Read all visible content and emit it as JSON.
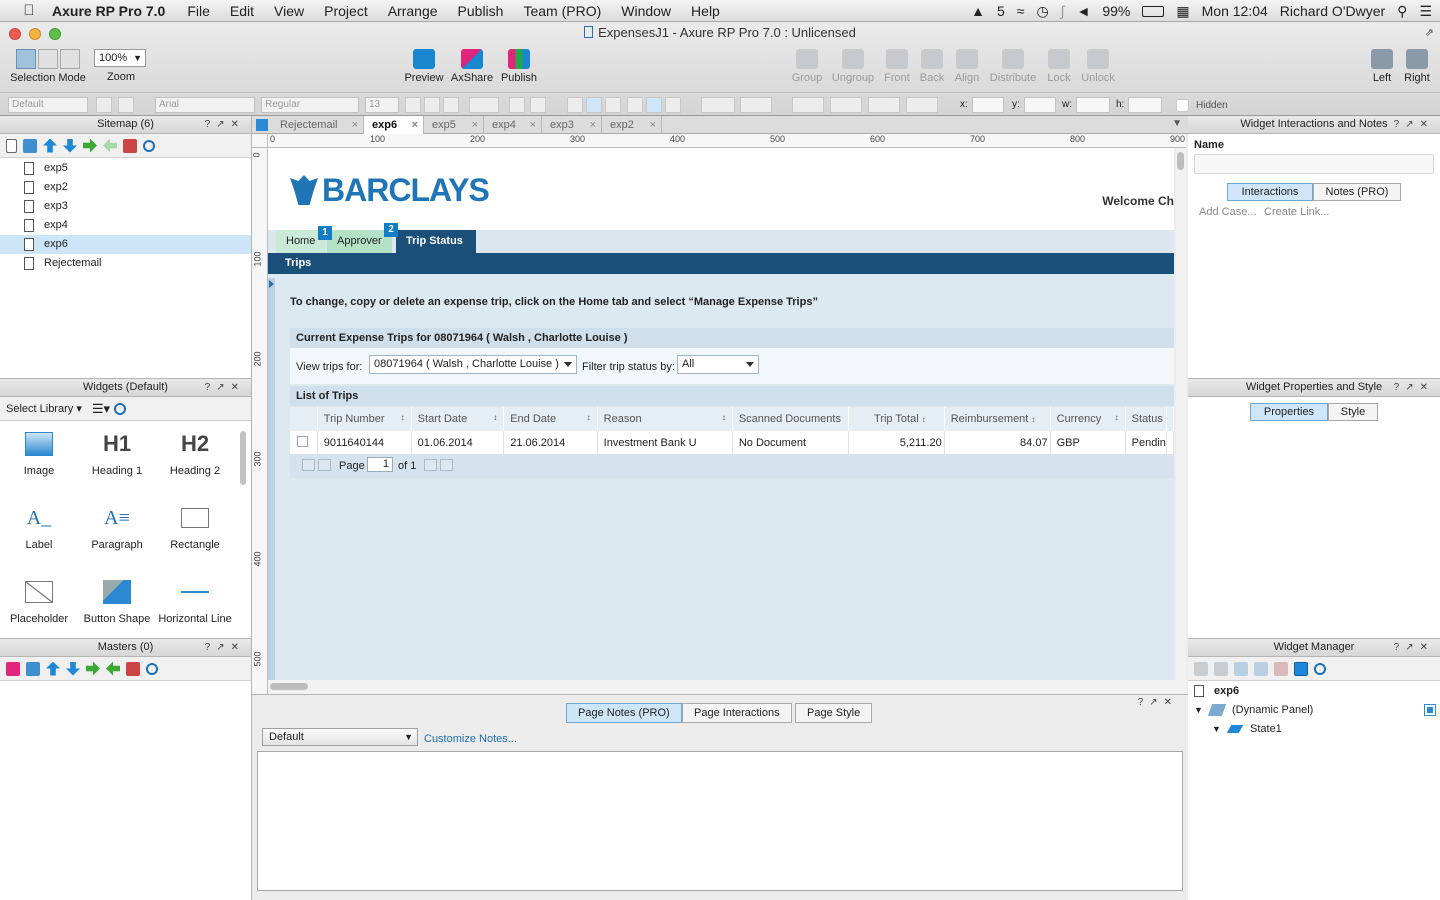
{
  "menubar": {
    "app": "Axure RP Pro 7.0",
    "items": [
      "File",
      "Edit",
      "View",
      "Project",
      "Arrange",
      "Publish",
      "Team (PRO)",
      "Window",
      "Help"
    ],
    "adobe": "5",
    "battery": "99%",
    "clock": "Mon 12:04",
    "user": "Richard O'Dwyer"
  },
  "window": {
    "title": "ExpensesJ1 - Axure RP Pro 7.0 : Unlicensed"
  },
  "toolbar": {
    "selection_mode": "Selection Mode",
    "zoom_label": "Zoom",
    "zoom_value": "100%",
    "preview": "Preview",
    "axshare": "AxShare",
    "publish": "Publish",
    "group": "Group",
    "ungroup": "Ungroup",
    "front": "Front",
    "back": "Back",
    "align": "Align",
    "distribute": "Distribute",
    "lock": "Lock",
    "unlock": "Unlock",
    "left": "Left",
    "right": "Right"
  },
  "format": {
    "style": "Default",
    "font": "Arial",
    "weight": "Regular",
    "size": "13",
    "x": "x:",
    "y": "y:",
    "w": "w:",
    "h": "h:",
    "hidden": "Hidden"
  },
  "sitemap": {
    "title": "Sitemap (6)",
    "pages": [
      "exp5",
      "exp2",
      "exp3",
      "exp4",
      "exp6",
      "Rejectemail"
    ],
    "selected": "exp6"
  },
  "widgets": {
    "title": "Widgets (Default)",
    "select_library": "Select Library",
    "items": [
      "Image",
      "Heading 1",
      "Heading 2",
      "Label",
      "Paragraph",
      "Rectangle",
      "Placeholder",
      "Button Shape",
      "Horizontal Line"
    ],
    "h1": "H1",
    "h2": "H2"
  },
  "masters": {
    "title": "Masters (0)"
  },
  "tabs": [
    "Rejectemail",
    "exp6",
    "exp5",
    "exp4",
    "exp3",
    "exp2"
  ],
  "ruler": {
    "h": [
      "0",
      "100",
      "200",
      "300",
      "400",
      "500",
      "600",
      "700",
      "800",
      "900"
    ],
    "v": [
      "0",
      "100",
      "200",
      "300",
      "400",
      "500"
    ]
  },
  "page": {
    "logo": "BARCLAYS",
    "welcome": "Welcome Ch",
    "nav": [
      "Home",
      "Approver",
      "Trip Status"
    ],
    "badges": [
      "1",
      "2"
    ],
    "subnav": "Trips",
    "instruction": "To change, copy or delete an expense trip, click on the Home tab and select “Manage Expense Trips”",
    "section1": "Current Expense Trips for 08071964 ( Walsh , Charlotte Louise )",
    "view_trips_label": "View trips for:",
    "view_trips_value": "08071964 ( Walsh , Charlotte Louise )",
    "filter_label": "Filter trip status by:",
    "filter_value": "All",
    "section2": "List of Trips",
    "columns": [
      "Trip Number",
      "Start Date",
      "End Date",
      "Reason",
      "Scanned Documents",
      "Trip Total",
      "Reimbursement",
      "Currency",
      "Status"
    ],
    "rows": [
      [
        "9011640144",
        "01.06.2014",
        "21.06.2014",
        "Investment Bank U",
        "No Document",
        "5,211.20",
        "84.07",
        "GBP",
        "Pendin"
      ]
    ],
    "pager_page": "Page",
    "pager_value": "1",
    "pager_of": "of 1"
  },
  "notes": {
    "tabs": [
      "Page Notes (PRO)",
      "Page Interactions",
      "Page Style"
    ],
    "select": "Default",
    "customize": "Customize Notes..."
  },
  "interactions": {
    "title": "Widget Interactions and Notes",
    "name_label": "Name",
    "tabs": [
      "Interactions",
      "Notes (PRO)"
    ],
    "add_case": "Add Case...",
    "create_link": "Create Link..."
  },
  "properties": {
    "title": "Widget Properties and Style",
    "tabs": [
      "Properties",
      "Style"
    ]
  },
  "manager": {
    "title": "Widget Manager",
    "page": "exp6",
    "panel": "(Dynamic Panel)",
    "state": "State1"
  }
}
